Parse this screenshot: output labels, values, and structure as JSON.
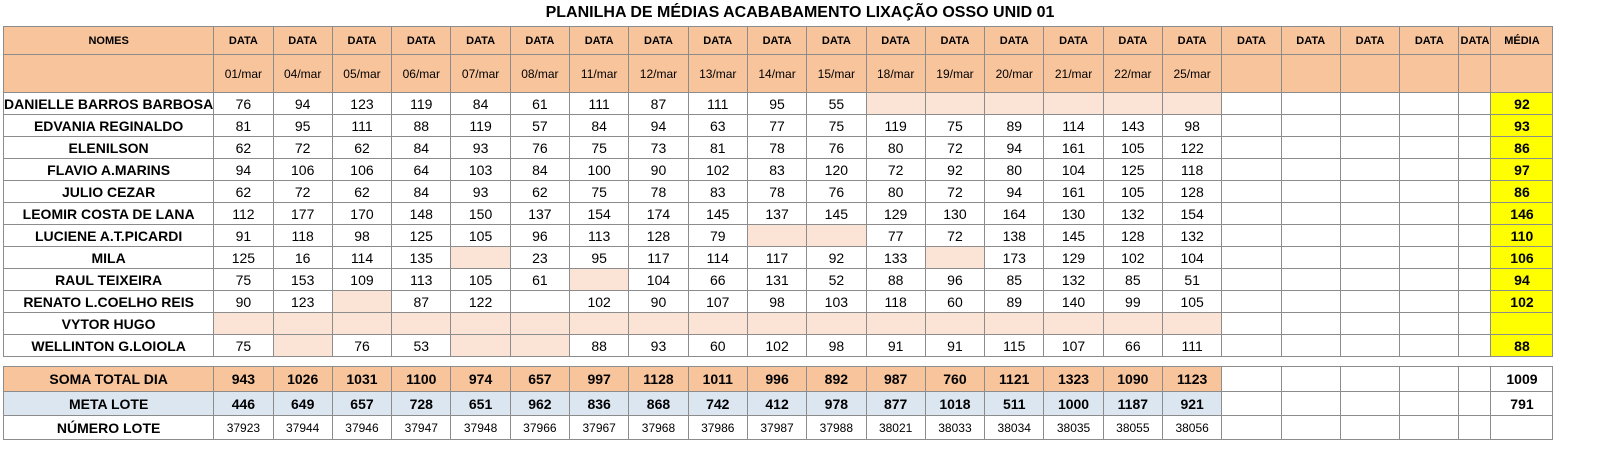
{
  "title": "PLANILHA DE MÉDIAS ACABABAMENTO LIXAÇÃO OSSO UNID 01",
  "header": {
    "names_label": "NOMES",
    "date_label": "DATA",
    "average_label": "MÉDIA",
    "dates": [
      "01/mar",
      "04/mar",
      "05/mar",
      "06/mar",
      "07/mar",
      "08/mar",
      "11/mar",
      "12/mar",
      "13/mar",
      "14/mar",
      "15/mar",
      "18/mar",
      "19/mar",
      "20/mar",
      "21/mar",
      "22/mar",
      "25/mar",
      "",
      "",
      "",
      "",
      ""
    ]
  },
  "rows": [
    {
      "name": "DANIELLE BARROS BARBOSA",
      "values": [
        "76",
        "94",
        "123",
        "119",
        "84",
        "61",
        "111",
        "87",
        "111",
        "95",
        "55",
        "",
        "",
        "",
        "",
        "",
        ""
      ],
      "peach": [
        11,
        12,
        13,
        14,
        15,
        16
      ],
      "average": "92"
    },
    {
      "name": "EDVANIA REGINALDO",
      "values": [
        "81",
        "95",
        "111",
        "88",
        "119",
        "57",
        "84",
        "94",
        "63",
        "77",
        "75",
        "119",
        "75",
        "89",
        "114",
        "143",
        "98"
      ],
      "peach": [],
      "average": "93"
    },
    {
      "name": "ELENILSON",
      "values": [
        "62",
        "72",
        "62",
        "84",
        "93",
        "76",
        "75",
        "73",
        "81",
        "78",
        "76",
        "80",
        "72",
        "94",
        "161",
        "105",
        "122"
      ],
      "peach": [],
      "average": "86"
    },
    {
      "name": "FLAVIO A.MARINS",
      "values": [
        "94",
        "106",
        "106",
        "64",
        "103",
        "84",
        "100",
        "90",
        "102",
        "83",
        "120",
        "72",
        "92",
        "80",
        "104",
        "125",
        "118"
      ],
      "peach": [],
      "average": "97"
    },
    {
      "name": "JULIO CEZAR",
      "values": [
        "62",
        "72",
        "62",
        "84",
        "93",
        "62",
        "75",
        "78",
        "83",
        "78",
        "76",
        "80",
        "72",
        "94",
        "161",
        "105",
        "128"
      ],
      "peach": [],
      "average": "86"
    },
    {
      "name": "LEOMIR COSTA DE LANA",
      "values": [
        "112",
        "177",
        "170",
        "148",
        "150",
        "137",
        "154",
        "174",
        "145",
        "137",
        "145",
        "129",
        "130",
        "164",
        "130",
        "132",
        "154"
      ],
      "peach": [],
      "average": "146"
    },
    {
      "name": "LUCIENE A.T.PICARDI",
      "values": [
        "91",
        "118",
        "98",
        "125",
        "105",
        "96",
        "113",
        "128",
        "79",
        "",
        "",
        "77",
        "72",
        "138",
        "145",
        "128",
        "132"
      ],
      "peach": [
        9,
        10
      ],
      "average": "110"
    },
    {
      "name": "MILA",
      "values": [
        "125",
        "16",
        "114",
        "135",
        "",
        "23",
        "95",
        "117",
        "114",
        "117",
        "92",
        "133",
        "",
        "173",
        "129",
        "102",
        "104"
      ],
      "peach": [
        4,
        12
      ],
      "average": "106"
    },
    {
      "name": "RAUL TEIXEIRA",
      "values": [
        "75",
        "153",
        "109",
        "113",
        "105",
        "61",
        "",
        "104",
        "66",
        "131",
        "52",
        "88",
        "96",
        "85",
        "132",
        "85",
        "51"
      ],
      "peach": [
        6
      ],
      "average": "94"
    },
    {
      "name": "RENATO L.COELHO REIS",
      "values": [
        "90",
        "123",
        "",
        "87",
        "122",
        "",
        "102",
        "90",
        "107",
        "98",
        "103",
        "118",
        "60",
        "89",
        "140",
        "99",
        "105"
      ],
      "peach": [
        2
      ],
      "average": "102"
    },
    {
      "name": "VYTOR HUGO",
      "values": [
        "",
        "",
        "",
        "",
        "",
        "",
        "",
        "",
        "",
        "",
        "",
        "",
        "",
        "",
        "",
        "",
        ""
      ],
      "peach": [
        0,
        1,
        2,
        3,
        4,
        5,
        6,
        7,
        8,
        9,
        10,
        11,
        12,
        13,
        14,
        15,
        16
      ],
      "average": ""
    },
    {
      "name": "WELLINTON G.LOIOLA",
      "values": [
        "75",
        "",
        "76",
        "53",
        "",
        "",
        "88",
        "93",
        "60",
        "102",
        "98",
        "91",
        "91",
        "115",
        "107",
        "66",
        "111"
      ],
      "peach": [
        1,
        4,
        5
      ],
      "average": "88"
    }
  ],
  "summary": {
    "soma": {
      "label": "SOMA TOTAL DIA",
      "values": [
        "943",
        "1026",
        "1031",
        "1100",
        "974",
        "657",
        "997",
        "1128",
        "1011",
        "996",
        "892",
        "987",
        "760",
        "1121",
        "1323",
        "1090",
        "1123"
      ],
      "average": "1009"
    },
    "meta": {
      "label": "META LOTE",
      "values": [
        "446",
        "649",
        "657",
        "728",
        "651",
        "962",
        "836",
        "868",
        "742",
        "412",
        "978",
        "877",
        "1018",
        "511",
        "1000",
        "1187",
        "921"
      ],
      "average": "791"
    },
    "lote": {
      "label": "NÚMERO LOTE",
      "values": [
        "37923",
        "37944",
        "37946",
        "37947",
        "37948",
        "37966",
        "37967",
        "37968",
        "37986",
        "37987",
        "37988",
        "38021",
        "38033",
        "38034",
        "38035",
        "38055",
        "38056"
      ],
      "average": ""
    }
  },
  "colors": {
    "header_bg": "#f8c49c",
    "peach": "#fbe4d5",
    "average_bg": "#ffff00",
    "meta_bg": "#dce6f1"
  }
}
